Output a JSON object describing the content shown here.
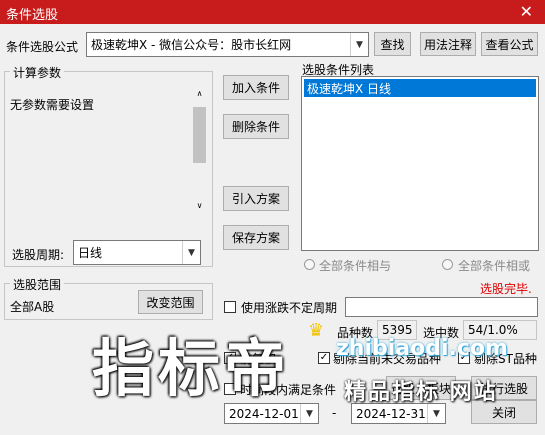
{
  "window": {
    "title": "条件选股"
  },
  "formula": {
    "label": "条件选股公式",
    "value": "极速乾坤X  -  微信公众号：股市长红网",
    "find_label": "查找",
    "usage_label": "用法注释",
    "view_label": "查看公式"
  },
  "params": {
    "group_title": "计算参数",
    "message": "无参数需要设置",
    "period_label": "选股周期:",
    "period_value": "日线"
  },
  "middle_buttons": {
    "add": "加入条件",
    "delete": "删除条件",
    "import": "引入方案",
    "save": "保存方案"
  },
  "condition_list": {
    "title": "选股条件列表",
    "items": [
      "极速乾坤X  日线"
    ]
  },
  "logic": {
    "and_label": "全部条件相与",
    "or_label": "全部条件相或"
  },
  "status": {
    "text": "选股完毕.",
    "color": "#e00000"
  },
  "scope": {
    "group_title": "选股范围",
    "value": "全部A股",
    "change_label": "改变范围"
  },
  "uncertain_period_label": "使用涨跌不定周期",
  "stats": {
    "count_label": "品种数",
    "count_value": "5395",
    "selected_label": "选中数",
    "selected_value": "54/1.0%"
  },
  "options": {
    "pre_label": "前复权",
    "not_label": "剔除当前未交易品种",
    "st_label": "剔除ST品种"
  },
  "time": {
    "label": "时间段内满足条件",
    "start": "2024-12-01",
    "separator": "-",
    "end": "2024-12-31"
  },
  "actions": {
    "to_block_label": "选股入板块",
    "execute_label": "执行选股",
    "close_label": "关闭"
  },
  "watermark": {
    "big_text": "指标帝",
    "site_text": "zhibiaodi.com",
    "small_text": "精品指标 网站"
  },
  "colors": {
    "titlebar": "#c81b1b",
    "selection": "#0078d7",
    "accent_watermark": "#2ba3d6"
  }
}
